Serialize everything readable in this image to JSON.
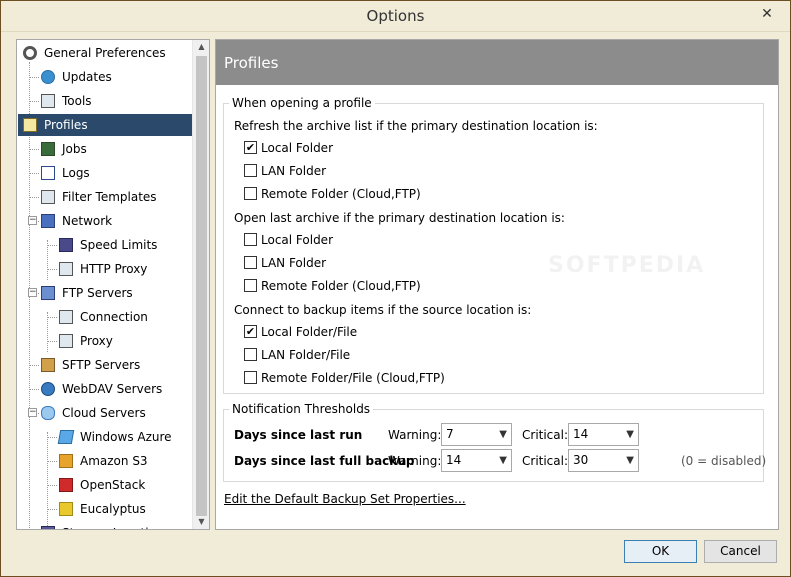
{
  "window": {
    "title": "Options",
    "close_glyph": "✕"
  },
  "nav": {
    "items": [
      {
        "label": "General Preferences",
        "icon": "gear-icon"
      },
      {
        "label": "Updates",
        "icon": "globe-icon"
      },
      {
        "label": "Tools",
        "icon": "tools-icon"
      },
      {
        "label": "Profiles",
        "icon": "profile-icon",
        "selected": true
      },
      {
        "label": "Jobs",
        "icon": "jobs-icon"
      },
      {
        "label": "Logs",
        "icon": "logs-icon"
      },
      {
        "label": "Filter Templates",
        "icon": "filter-icon"
      },
      {
        "label": "Network",
        "icon": "network-icon"
      },
      {
        "label": "Speed Limits",
        "icon": "speed-icon"
      },
      {
        "label": "HTTP Proxy",
        "icon": "proxy-icon"
      },
      {
        "label": "FTP Servers",
        "icon": "ftp-icon"
      },
      {
        "label": "Connection",
        "icon": "connection-icon"
      },
      {
        "label": "Proxy",
        "icon": "proxy-icon"
      },
      {
        "label": "SFTP Servers",
        "icon": "sftp-icon"
      },
      {
        "label": "WebDAV Servers",
        "icon": "webdav-icon"
      },
      {
        "label": "Cloud Servers",
        "icon": "cloud-icon"
      },
      {
        "label": "Windows Azure",
        "icon": "azure-icon"
      },
      {
        "label": "Amazon S3",
        "icon": "amazon-s3-icon"
      },
      {
        "label": "OpenStack",
        "icon": "openstack-icon"
      },
      {
        "label": "Eucalyptus",
        "icon": "eucalyptus-icon"
      },
      {
        "label": "Storage Locations",
        "icon": "storage-icon"
      }
    ]
  },
  "panel": {
    "title": "Profiles",
    "opening_group": {
      "title": "When opening a profile",
      "refresh_heading": "Refresh the archive list if the primary destination location is:",
      "refresh_options": [
        {
          "label": "Local Folder",
          "checked": true
        },
        {
          "label": "LAN Folder",
          "checked": false
        },
        {
          "label": "Remote Folder (Cloud,FTP)",
          "checked": false
        }
      ],
      "open_heading": "Open last archive if the primary destination location is:",
      "open_options": [
        {
          "label": "Local Folder",
          "checked": false
        },
        {
          "label": "LAN Folder",
          "checked": false
        },
        {
          "label": "Remote Folder (Cloud,FTP)",
          "checked": false
        }
      ],
      "connect_heading": "Connect to backup items if the source location is:",
      "connect_options": [
        {
          "label": "Local Folder/File",
          "checked": true
        },
        {
          "label": "LAN Folder/File",
          "checked": false
        },
        {
          "label": "Remote Folder/File (Cloud,FTP)",
          "checked": false
        }
      ]
    },
    "notification_group": {
      "title": "Notification Thresholds",
      "rows": [
        {
          "label": "Days since last run",
          "warning_label": "Warning:",
          "warning_value": "7",
          "critical_label": "Critical:",
          "critical_value": "14"
        },
        {
          "label": "Days since last full backup",
          "warning_label": "Warning:",
          "warning_value": "14",
          "critical_label": "Critical:",
          "critical_value": "30"
        }
      ],
      "hint": "(0 = disabled)"
    },
    "edit_link": "Edit the Default Backup Set Properties...",
    "watermark": "SOFTPEDIA"
  },
  "buttons": {
    "ok": "OK",
    "cancel": "Cancel"
  },
  "colors": {
    "selected_bg": "#2b4a6b",
    "header_bg": "#8c8c8c",
    "frame_bg": "#f0ecd8"
  },
  "check_glyph": "✔"
}
